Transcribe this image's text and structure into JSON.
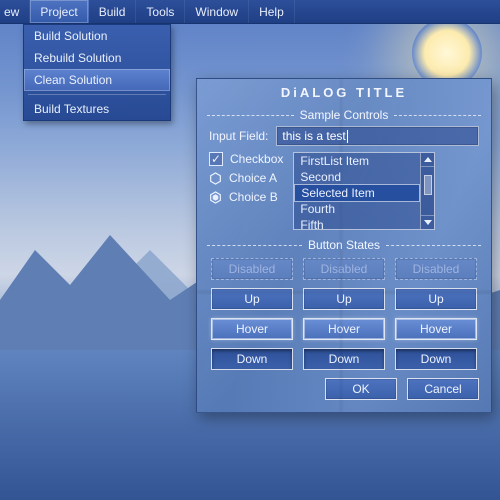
{
  "colors": {
    "accent": "#3a5fae",
    "highlight": "#264fa0"
  },
  "menubar": {
    "items": [
      "ew",
      "Project",
      "Build",
      "Tools",
      "Window",
      "Help"
    ],
    "open_index": 1,
    "dropdown": {
      "items": [
        "Build Solution",
        "Rebuild Solution",
        "Clean Solution"
      ],
      "hover_index": 2,
      "after_sep": [
        "Build Textures"
      ]
    }
  },
  "dialog": {
    "title": "DiALOG TITLE",
    "section1": "Sample Controls",
    "input_label": "Input Field:",
    "input_value": "this is a test",
    "checkbox_label": "Checkbox",
    "checkbox_checked": true,
    "radio": [
      {
        "label": "Choice A",
        "selected": false
      },
      {
        "label": "Choice B",
        "selected": true
      }
    ],
    "list": {
      "items": [
        "FirstList Item",
        "Second",
        "Selected Item",
        "Fourth",
        "Fifth"
      ],
      "selected_index": 2
    },
    "section2": "Button States",
    "button_labels": {
      "disabled": "Disabled",
      "up": "Up",
      "hover": "Hover",
      "down": "Down"
    },
    "ok": "OK",
    "cancel": "Cancel"
  }
}
